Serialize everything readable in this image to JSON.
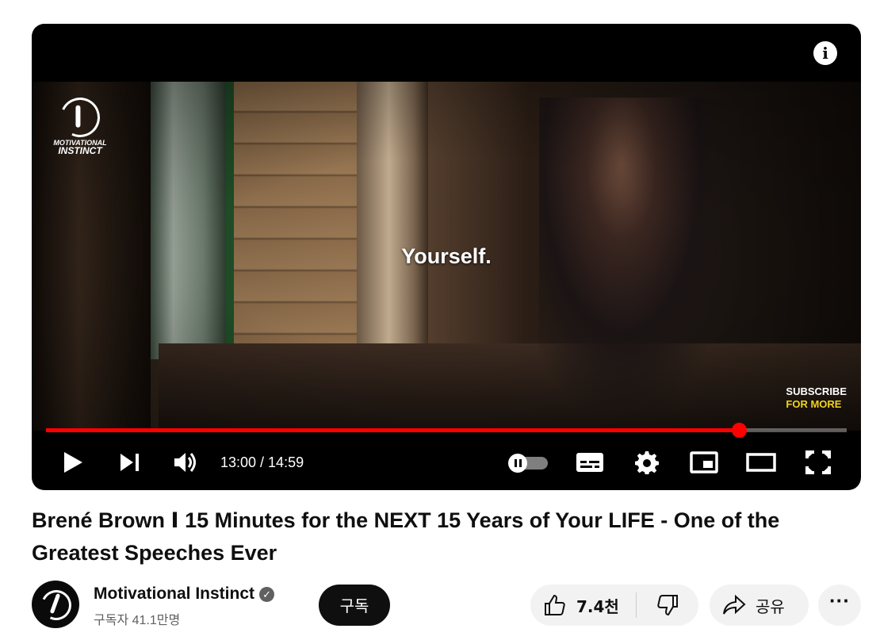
{
  "player": {
    "caption": "Yourself.",
    "watermark": {
      "line1": "MOTIVATIONAL",
      "line2": "INSTINCT"
    },
    "end_tag": {
      "line1": "SUBSCRIBE",
      "line2": "FOR MORE"
    },
    "info_icon": "info-icon",
    "progress_fraction": 0.8657,
    "current_time": "13:00",
    "duration": "14:59",
    "time_display": "13:00 / 14:59",
    "autoplay_on": false,
    "colors": {
      "progress": "#ff0000",
      "end_tag_accent": "#f1d21c"
    },
    "controls": [
      "play-icon",
      "next-icon",
      "volume-icon",
      "autoplay-toggle",
      "subtitles-icon",
      "settings-icon",
      "miniplayer-icon",
      "theater-mode-icon",
      "fullscreen-icon"
    ]
  },
  "video": {
    "title": "Brené Brown Ⅰ 15 Minutes for the NEXT 15 Years of Your LIFE - One of the Greatest Speeches Ever"
  },
  "channel": {
    "name": "Motivational Instinct",
    "verified": true,
    "subscribers": "구독자 41.1만명",
    "subscribe_label": "구독"
  },
  "actions": {
    "like_count": "7.4천",
    "share_label": "공유",
    "more_icon": "more-horizontal-icon"
  }
}
